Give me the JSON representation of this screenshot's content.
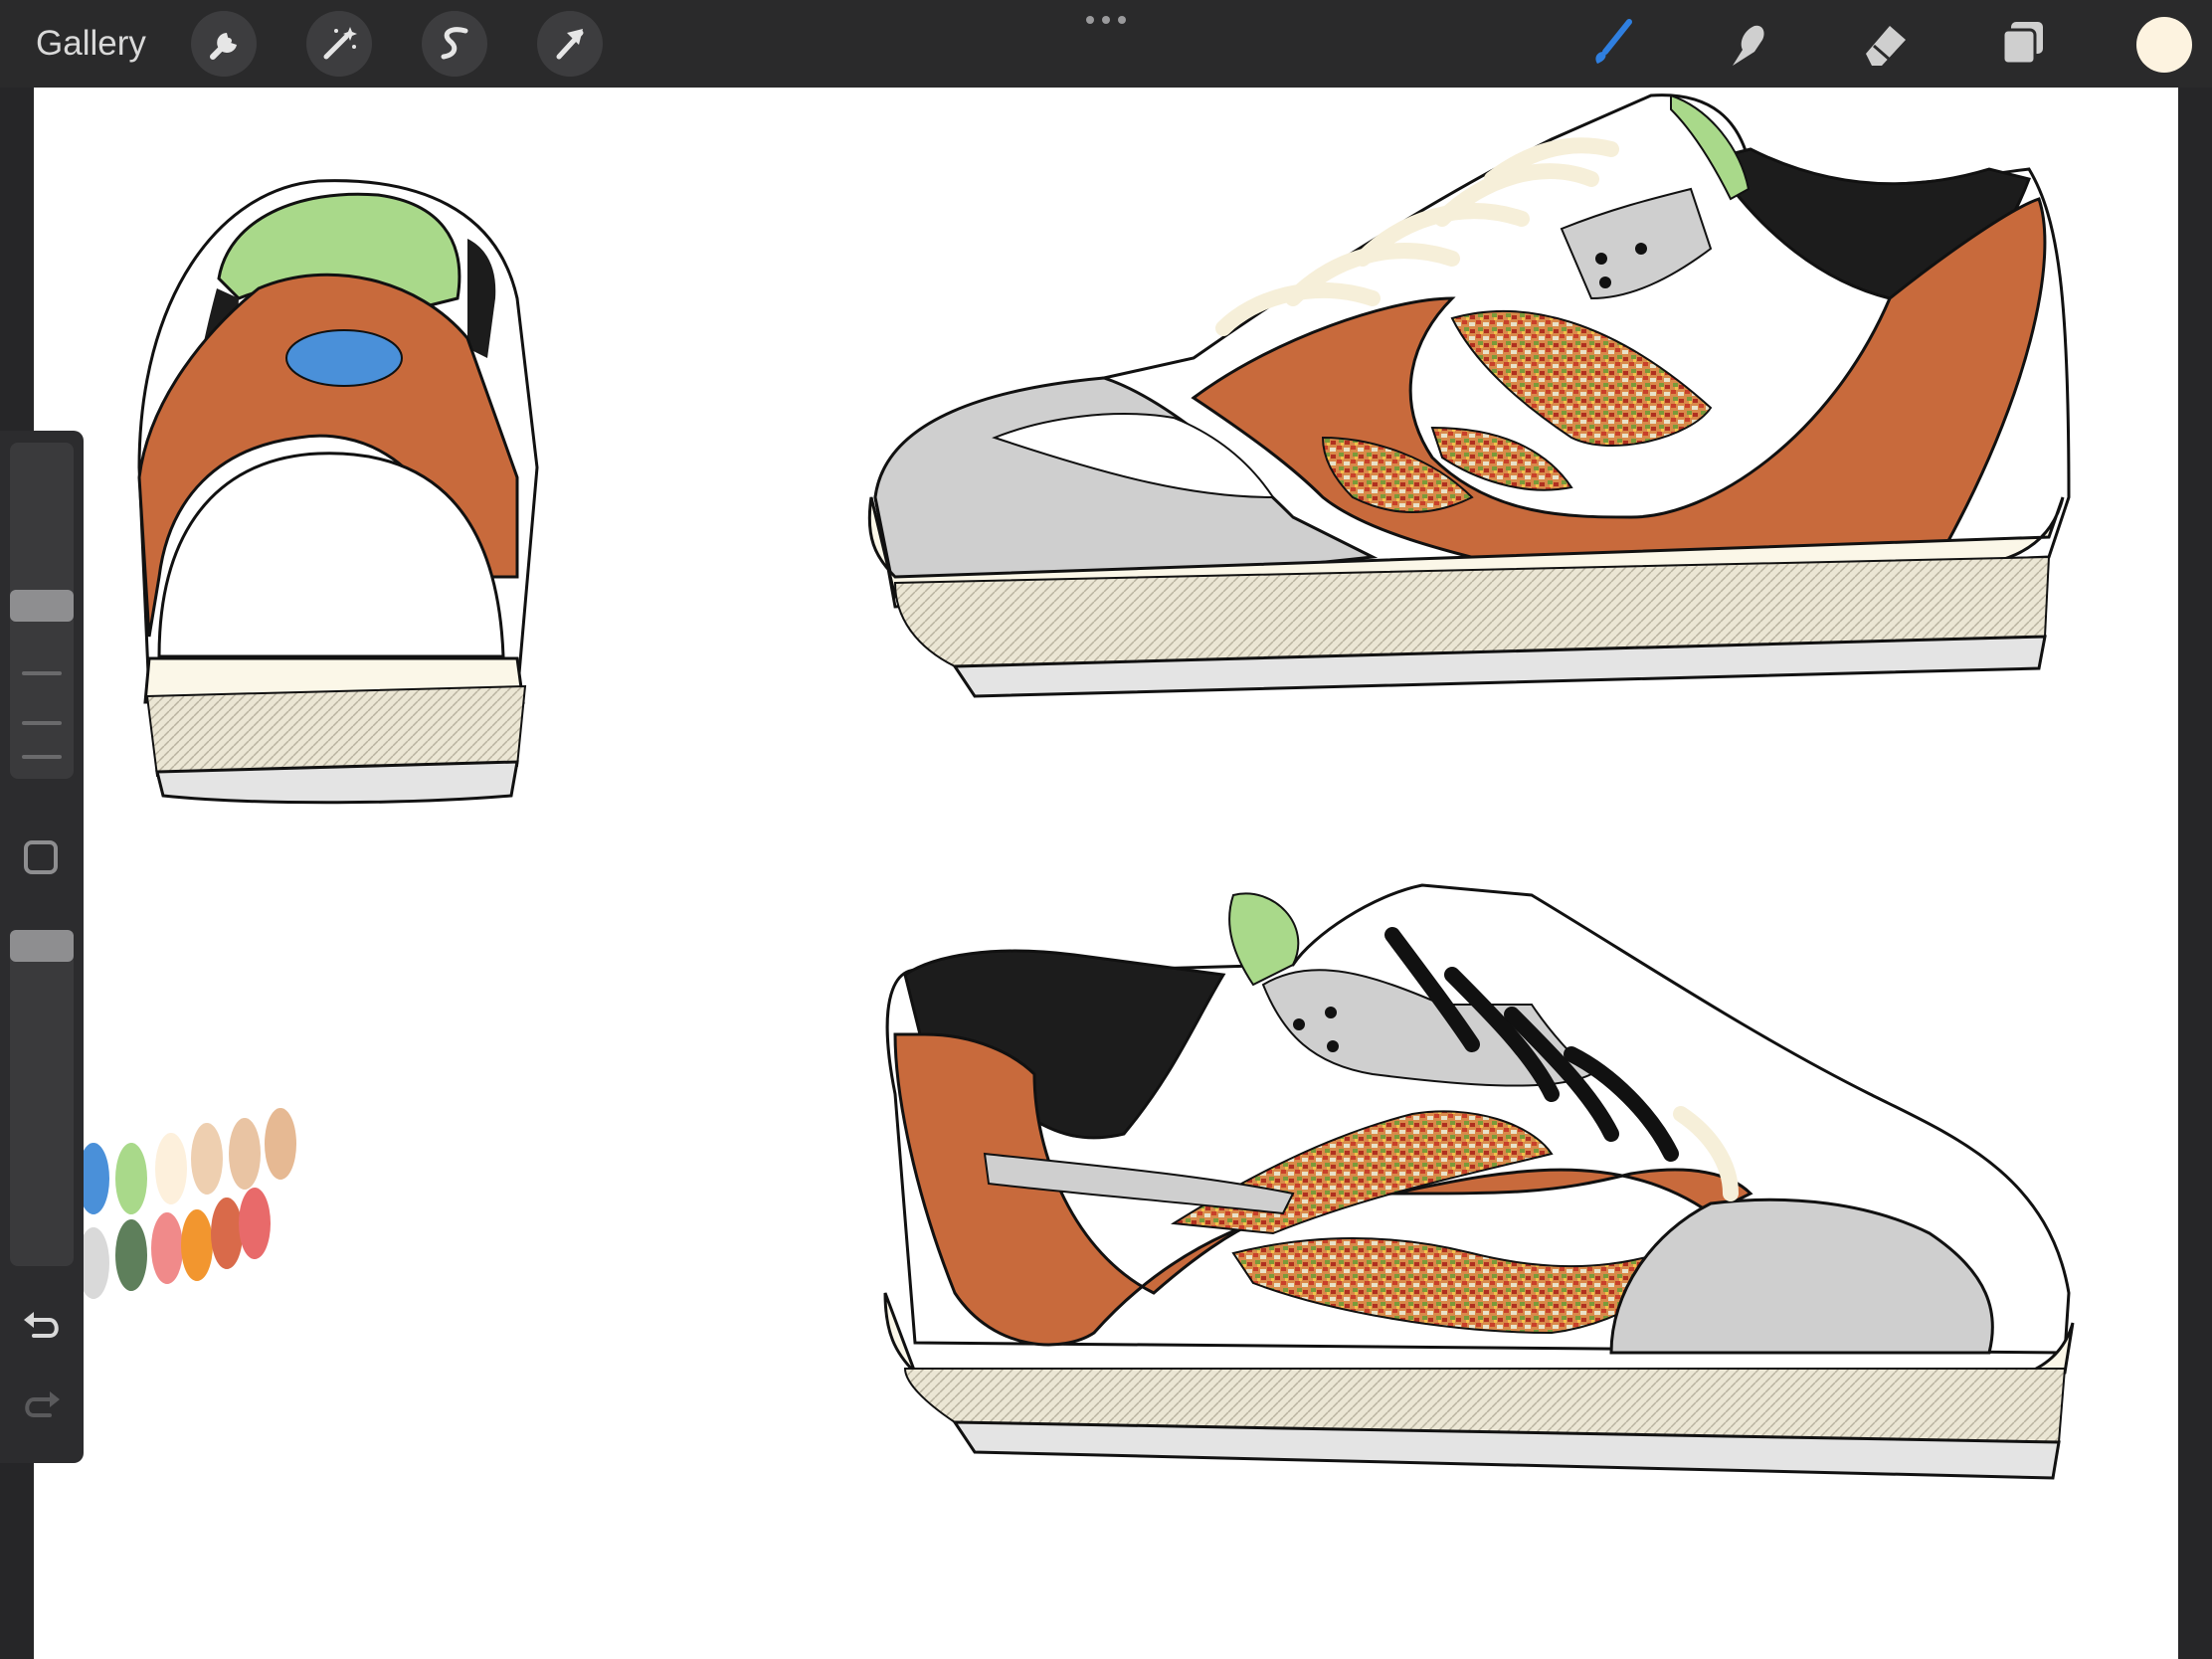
{
  "toolbar": {
    "gallery_label": "Gallery",
    "left_tools": [
      {
        "name": "actions",
        "icon": "wrench-icon"
      },
      {
        "name": "adjustments",
        "icon": "magic-wand-icon"
      },
      {
        "name": "selection",
        "icon": "selection-s-icon"
      },
      {
        "name": "transform",
        "icon": "arrow-cursor-icon"
      }
    ],
    "more_icon": "ellipsis-icon",
    "right_tools": [
      {
        "name": "paint",
        "icon": "brush-icon",
        "active": true
      },
      {
        "name": "smudge",
        "icon": "smudge-finger-icon",
        "active": false
      },
      {
        "name": "erase",
        "icon": "eraser-icon",
        "active": false
      },
      {
        "name": "layers",
        "icon": "layers-icon",
        "active": false
      }
    ],
    "current_color": "#fdf3e0",
    "active_tool_color": "#2f7fe0"
  },
  "sidebar": {
    "brush_size_icon": "slider-thumb",
    "modify_icon": "square-outline-icon",
    "undo_icon": "undo-arrow-icon",
    "redo_icon": "redo-arrow-icon"
  },
  "canvas": {
    "background": "#ffffff",
    "palette_colors": [
      "#4a90d9",
      "#a9d98a",
      "#fdf0dc",
      "#eecfb0",
      "#e9c4a3",
      "#e6b993",
      "#d9d9d9",
      "#5e7f5b",
      "#f08a8a",
      "#f2962f",
      "#d96a4a",
      "#e86a6a"
    ],
    "shoe_colors": {
      "rust": "#c86a3c",
      "gray": "#cfcfcf",
      "sole": "#fbf7e8",
      "lining_green": "#a9d98a",
      "collar_black": "#1c1c1c",
      "logo_blue": "#4a90d9",
      "lace_cream": "#f6efd9"
    }
  }
}
